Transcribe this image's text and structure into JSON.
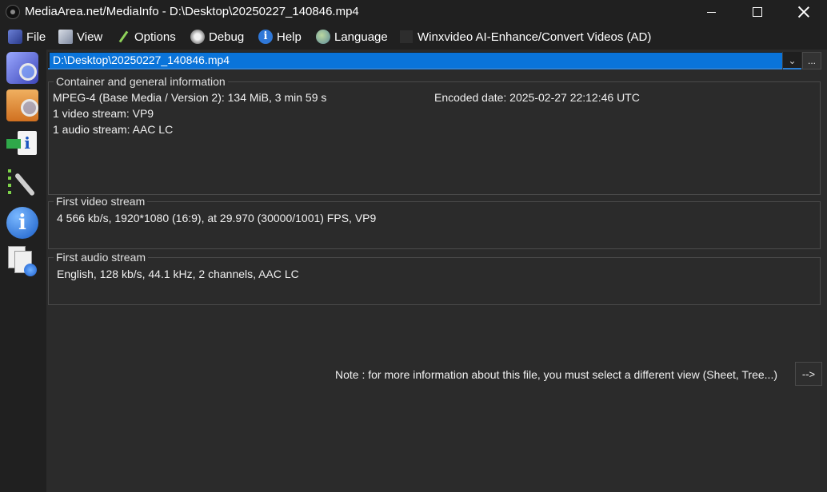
{
  "window": {
    "title": "MediaArea.net/MediaInfo - D:\\Desktop\\20250227_140846.mp4"
  },
  "menu": {
    "items": [
      {
        "label": "File",
        "icon": "file-icon"
      },
      {
        "label": "View",
        "icon": "view-icon"
      },
      {
        "label": "Options",
        "icon": "options-icon"
      },
      {
        "label": "Debug",
        "icon": "debug-icon"
      },
      {
        "label": "Help",
        "icon": "help-icon"
      },
      {
        "label": "Language",
        "icon": "globe-icon"
      },
      {
        "label": "Winxvideo AI-Enhance/Convert Videos (AD)",
        "icon": ""
      }
    ]
  },
  "sidebar": {
    "buttons": [
      "open-file-icon",
      "open-folder-icon",
      "export-icon",
      "preferences-icon",
      "about-icon",
      "web-icon"
    ]
  },
  "file_selector": {
    "value": "D:\\Desktop\\20250227_140846.mp4",
    "browse_label": "..."
  },
  "general": {
    "title": "Container and general information",
    "format_line": "MPEG-4 (Base Media / Version 2): 134 MiB, 3 min 59 s",
    "encoded_date": "Encoded date: 2025-02-27 22:12:46 UTC",
    "video_count": "1 video stream: VP9",
    "audio_count": "1 audio stream: AAC LC"
  },
  "video": {
    "title": "First video stream",
    "details": "4 566 kb/s, 1920*1080 (16:9), at 29.970 (30000/1001) FPS, VP9"
  },
  "audio": {
    "title": "First audio stream",
    "details": "English, 128 kb/s, 44.1 kHz, 2 channels, AAC LC"
  },
  "note": {
    "text": "Note : for more information about this file, you must select a different view (Sheet, Tree...)",
    "button_label": "-->"
  },
  "colors": {
    "background": "#202020",
    "panel": "#2b2b2b",
    "selection": "#0a74da"
  }
}
